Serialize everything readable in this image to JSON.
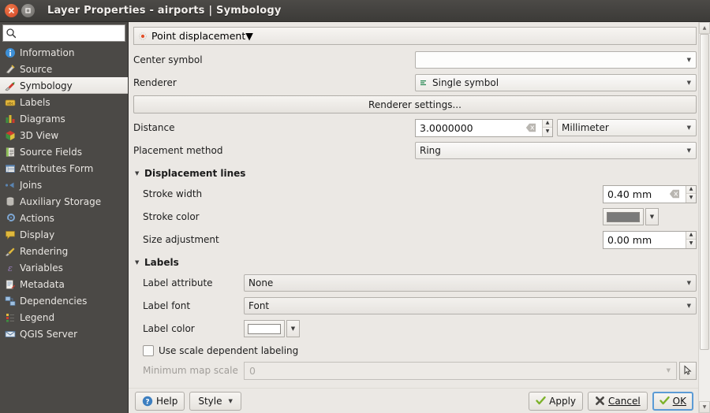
{
  "window": {
    "title": "Layer Properties - airports | Symbology",
    "close_label": "×",
    "maximize_label": "□"
  },
  "sidebar": {
    "search": {
      "value": "",
      "placeholder": ""
    },
    "items": [
      {
        "label": "Information",
        "icon": "information-icon",
        "selected": false
      },
      {
        "label": "Source",
        "icon": "source-icon",
        "selected": false
      },
      {
        "label": "Symbology",
        "icon": "symbology-icon",
        "selected": true
      },
      {
        "label": "Labels",
        "icon": "labels-icon",
        "selected": false
      },
      {
        "label": "Diagrams",
        "icon": "diagrams-icon",
        "selected": false
      },
      {
        "label": "3D View",
        "icon": "3d-view-icon",
        "selected": false
      },
      {
        "label": "Source Fields",
        "icon": "source-fields-icon",
        "selected": false
      },
      {
        "label": "Attributes Form",
        "icon": "attributes-form-icon",
        "selected": false
      },
      {
        "label": "Joins",
        "icon": "joins-icon",
        "selected": false
      },
      {
        "label": "Auxiliary Storage",
        "icon": "auxiliary-storage-icon",
        "selected": false
      },
      {
        "label": "Actions",
        "icon": "actions-icon",
        "selected": false
      },
      {
        "label": "Display",
        "icon": "display-icon",
        "selected": false
      },
      {
        "label": "Rendering",
        "icon": "rendering-icon",
        "selected": false
      },
      {
        "label": "Variables",
        "icon": "variables-icon",
        "selected": false
      },
      {
        "label": "Metadata",
        "icon": "metadata-icon",
        "selected": false
      },
      {
        "label": "Dependencies",
        "icon": "dependencies-icon",
        "selected": false
      },
      {
        "label": "Legend",
        "icon": "legend-icon",
        "selected": false
      },
      {
        "label": "QGIS Server",
        "icon": "qgis-server-icon",
        "selected": false
      }
    ]
  },
  "main": {
    "renderer_type": "Point displacement",
    "center_symbol": {
      "label": "Center symbol",
      "value": ""
    },
    "renderer": {
      "label": "Renderer",
      "value": "Single symbol"
    },
    "renderer_settings_button": "Renderer settings...",
    "distance": {
      "label": "Distance",
      "value": "3.0000000",
      "unit": "Millimeter"
    },
    "placement_method": {
      "label": "Placement method",
      "value": "Ring"
    },
    "displacement_lines": {
      "title": "Displacement lines",
      "stroke_width": {
        "label": "Stroke width",
        "value": "0.40 mm"
      },
      "stroke_color": {
        "label": "Stroke color",
        "value": "#7a7a7a"
      },
      "size_adjustment": {
        "label": "Size adjustment",
        "value": "0.00 mm"
      }
    },
    "labels": {
      "title": "Labels",
      "label_attribute": {
        "label": "Label attribute",
        "value": "None"
      },
      "label_font": {
        "label": "Label font",
        "value": "Font"
      },
      "label_color": {
        "label": "Label color",
        "value": "#ffffff"
      },
      "use_scale_dependent": {
        "label": "Use scale dependent labeling",
        "checked": false
      },
      "minimum_map_scale": {
        "label": "Minimum map scale",
        "value": "",
        "placeholder": "0"
      }
    }
  },
  "buttons": {
    "help": "Help",
    "style": "Style",
    "apply": "Apply",
    "cancel": "Cancel",
    "ok": "OK"
  },
  "colors": {
    "titlebar": "#3c3b38",
    "sidebar": "#4b4946",
    "panel": "#ebe8e4",
    "accent": "#5b9bd5",
    "check_green": "#7db22b"
  }
}
